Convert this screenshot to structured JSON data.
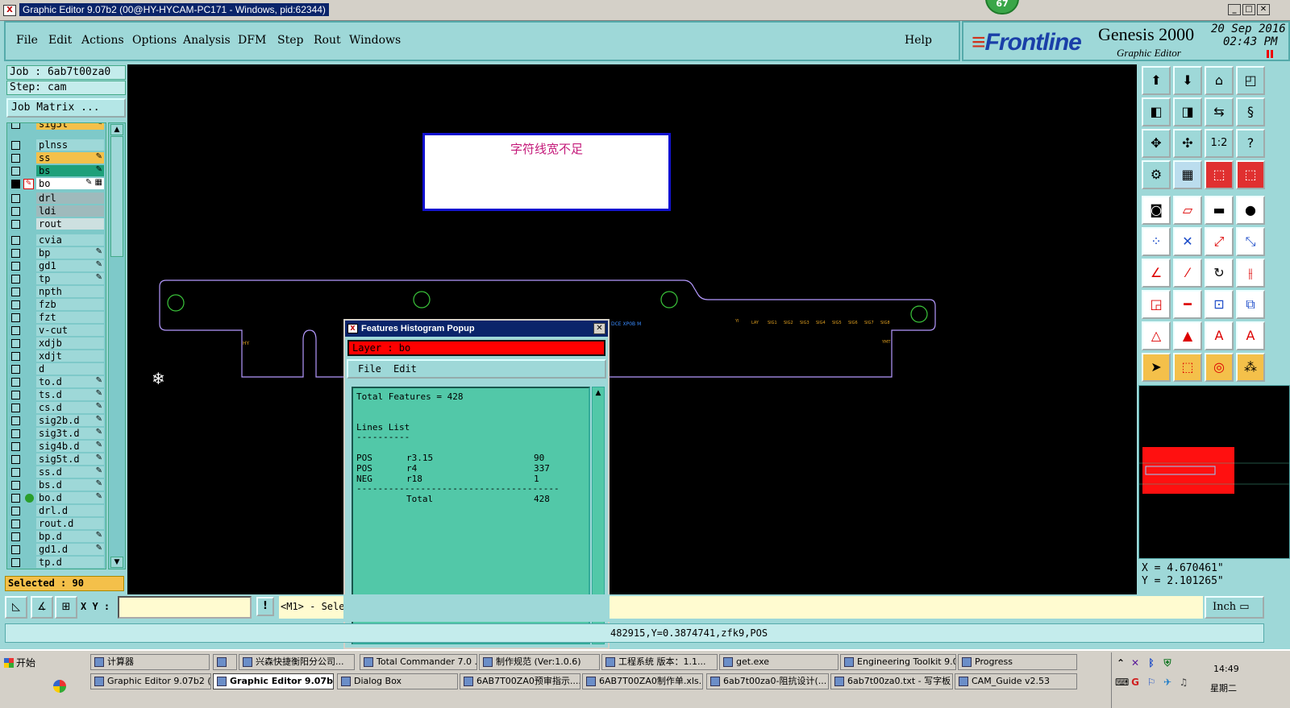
{
  "window": {
    "title": "Graphic Editor 9.07b2 (00@HY-HYCAM-PC171 - Windows, pid:62344)",
    "badge": "67",
    "min": "_",
    "max": "□",
    "close": "✕"
  },
  "menu": [
    "File",
    "Edit",
    "Actions",
    "Options",
    "Analysis",
    "DFM",
    "Step",
    "Rout",
    "Windows"
  ],
  "help": "Help",
  "brand": {
    "logo": "Frontline",
    "product": "Genesis 2000",
    "subtitle": "Graphic Editor",
    "date": "20 Sep 2016",
    "time": "02:43 PM"
  },
  "job": {
    "job_label": "Job : 6ab7t00za0",
    "step_label": "Step: cam",
    "matrix_button": "Job Matrix ..."
  },
  "layers": [
    {
      "name": "sig5t",
      "color": "#f4c04a",
      "mark": "✎",
      "cut": true
    },
    {
      "name": "plnss",
      "color": "#9ed8d8",
      "mark": ""
    },
    {
      "name": "ss",
      "color": "#f4c04a",
      "mark": "✎"
    },
    {
      "name": "bs",
      "color": "#1fa07a",
      "mark": "✎"
    },
    {
      "name": "bo",
      "color": "#ffffff",
      "mark": "✎ ▦",
      "selected": true,
      "pen": true
    },
    {
      "name": "drl",
      "color": "#9fbabc",
      "mark": ""
    },
    {
      "name": "ldi",
      "color": "#9fbabc",
      "mark": ""
    },
    {
      "name": "rout",
      "color": "#cde0e0",
      "mark": ""
    },
    {
      "name": "cvia",
      "color": "#9ed8d8",
      "mark": ""
    },
    {
      "name": "bp",
      "color": "#9ed8d8",
      "mark": "✎"
    },
    {
      "name": "gd1",
      "color": "#9ed8d8",
      "mark": "✎"
    },
    {
      "name": "tp",
      "color": "#9ed8d8",
      "mark": "✎"
    },
    {
      "name": "npth",
      "color": "#9ed8d8",
      "mark": ""
    },
    {
      "name": "fzb",
      "color": "#9ed8d8",
      "mark": ""
    },
    {
      "name": "fzt",
      "color": "#9ed8d8",
      "mark": ""
    },
    {
      "name": "v-cut",
      "color": "#9ed8d8",
      "mark": ""
    },
    {
      "name": "xdjb",
      "color": "#9ed8d8",
      "mark": ""
    },
    {
      "name": "xdjt",
      "color": "#9ed8d8",
      "mark": ""
    },
    {
      "name": "d",
      "color": "#9ed8d8",
      "mark": ""
    },
    {
      "name": "to.d",
      "color": "#9ed8d8",
      "mark": "✎"
    },
    {
      "name": "ts.d",
      "color": "#9ed8d8",
      "mark": "✎"
    },
    {
      "name": "cs.d",
      "color": "#9ed8d8",
      "mark": "✎"
    },
    {
      "name": "sig2b.d",
      "color": "#9ed8d8",
      "mark": "✎"
    },
    {
      "name": "sig3t.d",
      "color": "#9ed8d8",
      "mark": "✎"
    },
    {
      "name": "sig4b.d",
      "color": "#9ed8d8",
      "mark": "✎"
    },
    {
      "name": "sig5t.d",
      "color": "#9ed8d8",
      "mark": "✎"
    },
    {
      "name": "ss.d",
      "color": "#9ed8d8",
      "mark": "✎"
    },
    {
      "name": "bs.d",
      "color": "#9ed8d8",
      "mark": "✎"
    },
    {
      "name": "bo.d",
      "color": "#9ed8d8",
      "mark": "✎",
      "dot": true
    },
    {
      "name": "drl.d",
      "color": "#9ed8d8",
      "mark": ""
    },
    {
      "name": "rout.d",
      "color": "#9ed8d8",
      "mark": ""
    },
    {
      "name": "bp.d",
      "color": "#9ed8d8",
      "mark": "✎"
    },
    {
      "name": "gd1.d",
      "color": "#9ed8d8",
      "mark": "✎"
    },
    {
      "name": "tp.d",
      "color": "#9ed8d8",
      "mark": ""
    }
  ],
  "selected_label": "Selected : 90",
  "canvas": {
    "alert_text": "字符线宽不足",
    "cursor_glyph": "❄"
  },
  "popup": {
    "title": "Features Histogram Popup",
    "icon": "X",
    "close": "✕",
    "layer_label": "Layer :  bo",
    "menu_file": "File",
    "menu_edit": "Edit",
    "total_features": "Total Features = 428",
    "lines_list": "Lines List",
    "underline": "----------",
    "rows": [
      {
        "pol": "POS",
        "sym": "r3.15",
        "count": "90"
      },
      {
        "pol": "POS",
        "sym": "r4",
        "count": "337"
      },
      {
        "pol": "NEG",
        "sym": "r18",
        "count": "1"
      }
    ],
    "separator": "--------------------------------------",
    "total_label": "Total",
    "total_value": "428"
  },
  "coords": {
    "x": "X = 4.670461\"",
    "y": "Y = 2.101265\""
  },
  "command": {
    "xy_label": "X Y :",
    "xy_value": "",
    "hint": "<M1> - Sele",
    "unit": "Inch ▭",
    "status": "482915,Y=0.3874741,zfk9,POS"
  },
  "taskbar": {
    "start": "开始",
    "row1": [
      "计算器",
      "",
      "兴森快捷衡阳分公司...",
      "Total Commander 7.0 ...",
      "制作规范 (Ver:1.0.6)",
      "工程系统  版本：1.1...",
      "get.exe",
      "Engineering Toolkit 9.0...",
      "Progress"
    ],
    "row2": [
      "Graphic Editor 9.07b2 (...",
      "Graphic Editor 9.07b...",
      "Dialog Box",
      "6AB7T00ZA0预审指示....",
      "6AB7T00ZA0制作单.xls...",
      "6ab7t00za0-阻抗设计(...",
      "6ab7t00za0.txt - 写字板",
      "CAM_Guide v2.53"
    ],
    "clock": "14:49",
    "day": "星期二"
  }
}
